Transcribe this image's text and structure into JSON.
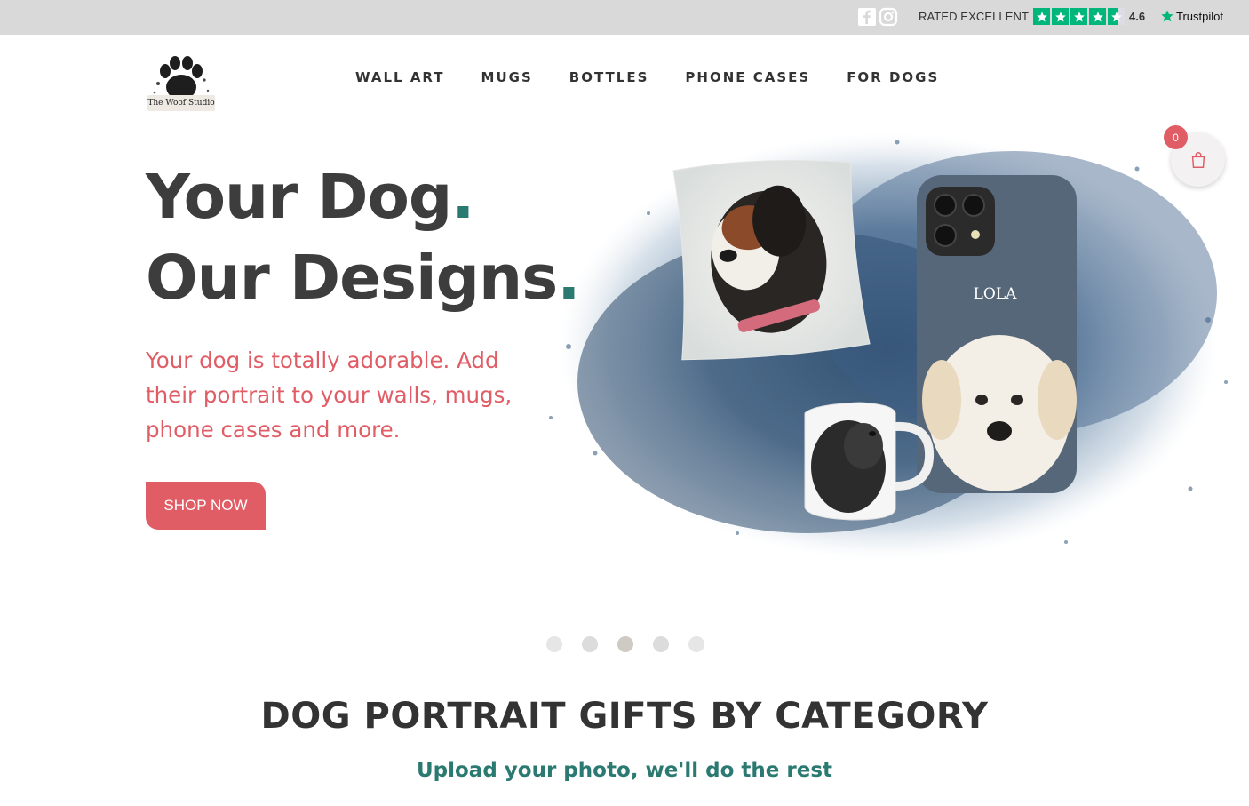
{
  "topbar": {
    "rated_text": "RATED EXCELLENT",
    "rating": "4.6",
    "trustpilot": "Trustpilot",
    "star_color": "#00b67a"
  },
  "header": {
    "logo_text": "The Woof Studio",
    "nav": [
      {
        "label": "WALL ART"
      },
      {
        "label": "MUGS"
      },
      {
        "label": "BOTTLES"
      },
      {
        "label": "PHONE CASES"
      },
      {
        "label": "FOR DOGS"
      }
    ],
    "cart_count": "0"
  },
  "hero": {
    "line1": "Your Dog",
    "line2": "Our Designs",
    "dot": ".",
    "subtitle": "Your dog is totally adorable. Add their portrait to your walls, mugs, phone cases and more.",
    "button": "SHOP NOW",
    "phone_name": "LOLA",
    "accent": "#e05d66",
    "teal": "#2b7a72"
  },
  "slider": {
    "count": 5,
    "active_index": 2
  },
  "category": {
    "title": "DOG PORTRAIT GIFTS BY CATEGORY",
    "subtitle": "Upload your photo, we'll do the rest"
  }
}
